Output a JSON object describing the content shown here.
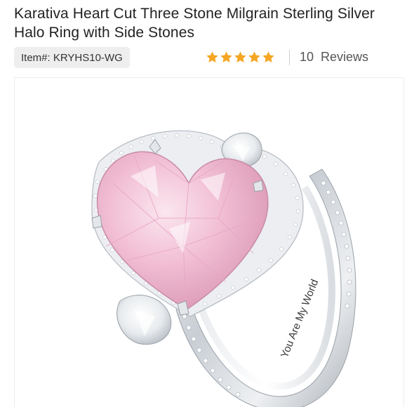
{
  "product": {
    "title": "Karativa Heart Cut Three Stone Milgrain Sterling Silver Halo Ring with Side Stones",
    "item_label": "Item#:",
    "item_number": "KRYHS10-WG",
    "rating": {
      "stars_filled": 5,
      "stars_total": 5,
      "review_count": "10",
      "review_label": "Reviews",
      "star_color": "#f5a623"
    },
    "image": {
      "engraving": "You Are My World",
      "stone_color": "#f3c6d8",
      "metal_color": "#d9dde2"
    }
  }
}
